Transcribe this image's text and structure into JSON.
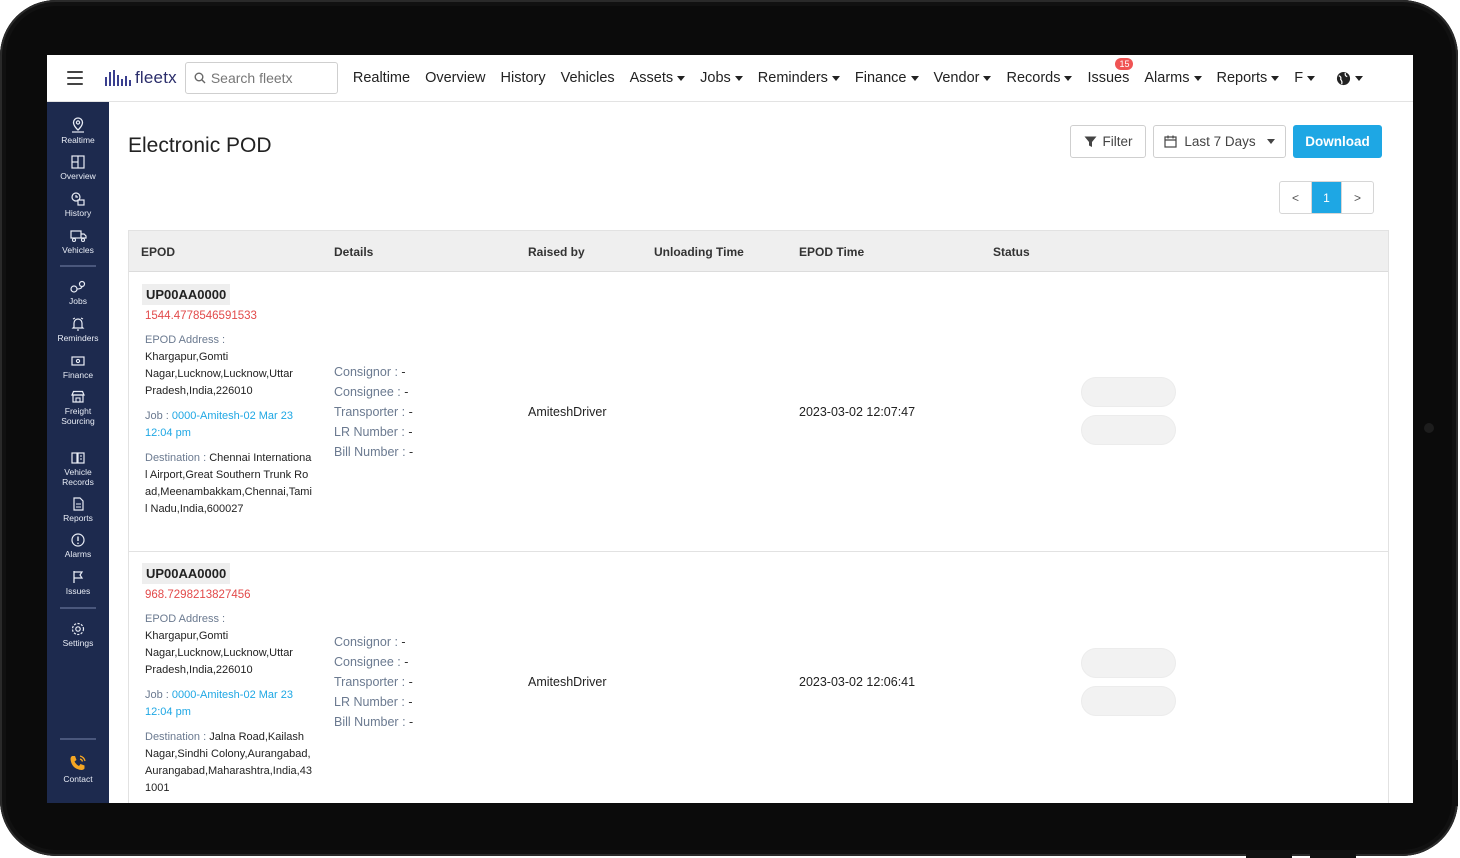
{
  "nav": {
    "logo_text": "fleetx",
    "search_placeholder": "Search fleetx",
    "links": [
      {
        "label": "Realtime",
        "dropdown": false
      },
      {
        "label": "Overview",
        "dropdown": false
      },
      {
        "label": "History",
        "dropdown": false
      },
      {
        "label": "Vehicles",
        "dropdown": false
      },
      {
        "label": "Assets",
        "dropdown": true
      },
      {
        "label": "Jobs",
        "dropdown": true
      },
      {
        "label": "Reminders",
        "dropdown": true
      },
      {
        "label": "Finance",
        "dropdown": true
      },
      {
        "label": "Vendor",
        "dropdown": true
      },
      {
        "label": "Records",
        "dropdown": true
      },
      {
        "label": "Issues",
        "dropdown": false,
        "badge": "15"
      },
      {
        "label": "Alarms",
        "dropdown": true
      },
      {
        "label": "Reports",
        "dropdown": true
      },
      {
        "label": "F",
        "dropdown": true
      }
    ]
  },
  "sidebar": {
    "items": [
      {
        "label": "Realtime",
        "icon": "map-pin-icon"
      },
      {
        "label": "Overview",
        "icon": "grid-icon"
      },
      {
        "label": "History",
        "icon": "history-icon"
      },
      {
        "label": "Vehicles",
        "icon": "truck-icon"
      },
      {
        "label": "Jobs",
        "icon": "route-icon"
      },
      {
        "label": "Reminders",
        "icon": "bell-icon"
      },
      {
        "label": "Finance",
        "icon": "wallet-icon"
      },
      {
        "label": "Freight Sourcing",
        "icon": "store-icon"
      },
      {
        "label": "Vehicle Records",
        "icon": "records-icon"
      },
      {
        "label": "Reports",
        "icon": "document-icon"
      },
      {
        "label": "Alarms",
        "icon": "alert-icon"
      },
      {
        "label": "Issues",
        "icon": "flag-icon"
      },
      {
        "label": "Settings",
        "icon": "gear-icon"
      }
    ],
    "contact_label": "Contact"
  },
  "page": {
    "title": "Electronic POD",
    "filter_label": "Filter",
    "range_label": "Last 7 Days",
    "download_label": "Download",
    "pager": {
      "prev": "<",
      "current": "1",
      "next": ">"
    }
  },
  "table": {
    "headers": [
      "EPOD",
      "Details",
      "Raised by",
      "Unloading Time",
      "EPOD Time",
      "Status"
    ],
    "rows": [
      {
        "vehicle": "UP00AA0000",
        "number": "1544.4778546591533",
        "address_label": "EPOD Address :",
        "address": "Khargapur,Gomti Nagar,Lucknow,Lucknow,Uttar Pradesh,India,226010",
        "job_label": "Job :",
        "job": "0000-Amitesh-02 Mar 23 12:04 pm",
        "destination_label": "Destination :",
        "destination": "Chennai International Airport,Great Southern Trunk Road,Meenambakkam,Chennai,Tamil Nadu,India,600027",
        "consignor_label": "Consignor :",
        "consignor": "-",
        "consignee_label": "Consignee :",
        "consignee": "-",
        "transporter_label": "Transporter :",
        "transporter": "-",
        "lr_label": "LR Number :",
        "lr": "-",
        "bill_label": "Bill Number :",
        "bill": "-",
        "raised_by": "AmiteshDriver",
        "epod_time": "2023-03-02 12:07:47"
      },
      {
        "vehicle": "UP00AA0000",
        "number": "968.7298213827456",
        "address_label": "EPOD Address :",
        "address": "Khargapur,Gomti Nagar,Lucknow,Lucknow,Uttar Pradesh,India,226010",
        "job_label": "Job :",
        "job": "0000-Amitesh-02 Mar 23 12:04 pm",
        "destination_label": "Destination :",
        "destination": "Jalna Road,Kailash Nagar,Sindhi Colony,Aurangabad,Aurangabad,Maharashtra,India,431001",
        "consignor_label": "Consignor :",
        "consignor": "-",
        "consignee_label": "Consignee :",
        "consignee": "-",
        "transporter_label": "Transporter :",
        "transporter": "-",
        "lr_label": "LR Number :",
        "lr": "-",
        "bill_label": "Bill Number :",
        "bill": "-",
        "raised_by": "AmiteshDriver",
        "epod_time": "2023-03-02 12:06:41"
      }
    ]
  },
  "colors": {
    "sidebar_bg": "#1d2a4e",
    "accent": "#1ea7e4",
    "badge": "#f05454",
    "epod_number": "#e24a4a"
  }
}
